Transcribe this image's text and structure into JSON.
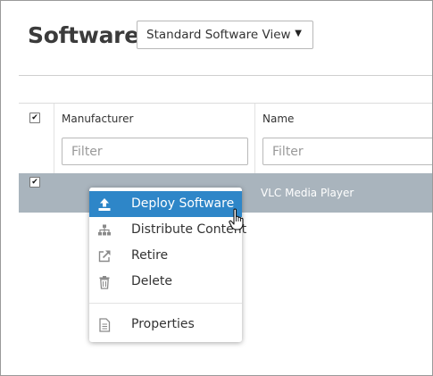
{
  "header": {
    "title": "Software",
    "view_select": {
      "value": "Standard Software View",
      "caret": "▼"
    }
  },
  "table": {
    "header_checkbox": "✔",
    "columns": [
      {
        "label": "Manufacturer",
        "filter_placeholder": "Filter"
      },
      {
        "label": "Name",
        "filter_placeholder": "Filter"
      }
    ],
    "rows": [
      {
        "selected": true,
        "checkbox": "✔",
        "manufacturer": "",
        "name": "VLC Media Player"
      }
    ]
  },
  "context_menu": {
    "items": [
      {
        "label": "Deploy Software",
        "icon": "upload-icon",
        "active": true
      },
      {
        "label": "Distribute Content",
        "icon": "sitemap-icon",
        "active": false
      },
      {
        "label": "Retire",
        "icon": "external-link-icon",
        "active": false
      },
      {
        "label": "Delete",
        "icon": "trash-icon",
        "active": false
      },
      {
        "label": "Properties",
        "icon": "document-icon",
        "active": false
      }
    ]
  },
  "colors": {
    "accent": "#2e86c8",
    "selected_row": "#a9b4bd",
    "icon_gray": "#8a8a8a"
  }
}
